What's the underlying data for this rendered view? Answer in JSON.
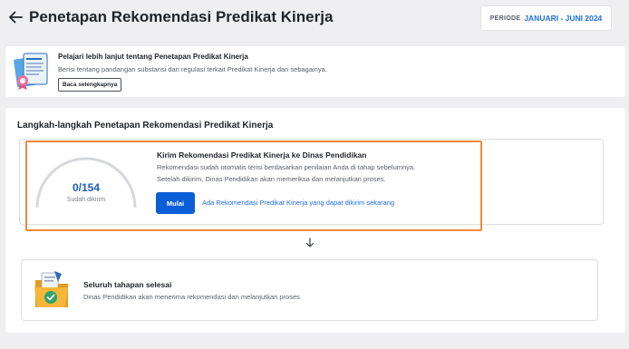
{
  "header": {
    "title": "Penetapan Rekomendasi Predikat Kinerja",
    "period_label": "PERIODE",
    "period_value": "JANUARI - JUNI 2024"
  },
  "info": {
    "title": "Pelajari lebih lanjut tentang Penetapan Predikat Kinerja",
    "description": "Berisi tentang pandangan substansi dan regulasi terkait Predikat Kinerja dan sebagainya.",
    "button": "Baca selengkapnya"
  },
  "steps": {
    "title": "Langkah-langkah Penetapan Rekomendasi Predikat Kinerja",
    "step1": {
      "progress_text": "0/154",
      "progress_sent": 0,
      "progress_total": 154,
      "progress_label": "Sudah dikirim",
      "title": "Kirim Rekomendasi Predikat Kinerja ke Dinas Pendidikan",
      "desc_line1": "Rekomendasi sudah otomatis terisi berdasarkan penilaian Anda di tahap sebelumnya.",
      "desc_line2": "Setelah dikirim, Dinas Pendidikan akan memeriksa dan melanjutkan proses.",
      "button": "Mulai",
      "link": "Ada Rekomendasi Predikat Kinerja yang dapat dikirim sekarang"
    },
    "step2": {
      "title": "Seluruh tahapan selesai",
      "description": "Dinas Pendidikan akan menerima rekomendasi dan melanjutkan proses."
    }
  },
  "colors": {
    "primary": "#0b5ed7",
    "link": "#1d6fe0",
    "highlight": "#f08a3c",
    "background": "#efeff1"
  },
  "icons": [
    "arrow-left-icon",
    "document-stack-icon",
    "arrow-down-icon",
    "folder-check-icon"
  ]
}
